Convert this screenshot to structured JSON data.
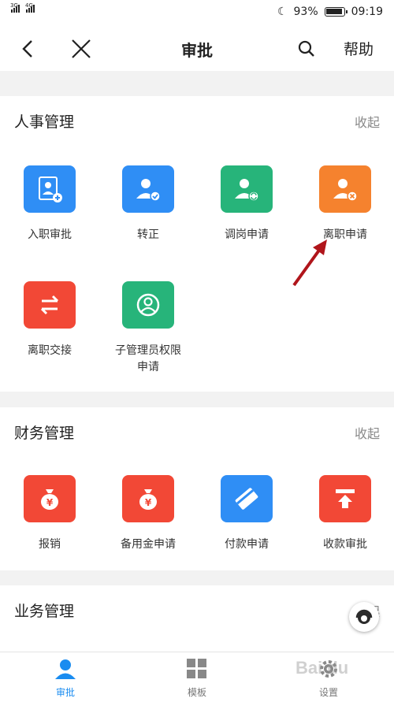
{
  "status_bar": {
    "sim1_label": "3G",
    "sim2_label": "4G",
    "battery": "93%",
    "time": "09:19"
  },
  "title_bar": {
    "title": "审批",
    "help_label": "帮助"
  },
  "sections": {
    "hr": {
      "title": "人事管理",
      "collapse": "收起",
      "items": [
        {
          "label": "入职审批",
          "color": "#2f8ef5",
          "icon": "photo-add-icon"
        },
        {
          "label": "转正",
          "color": "#2f8ef5",
          "icon": "user-check-icon"
        },
        {
          "label": "调岗申请",
          "color": "#27b47a",
          "icon": "user-transfer-icon"
        },
        {
          "label": "离职申请",
          "color": "#f5822e",
          "icon": "user-remove-icon"
        },
        {
          "label": "离职交接",
          "color": "#f24836",
          "icon": "exchange-icon"
        },
        {
          "label": "子管理员权限申请",
          "color": "#27b47a",
          "icon": "admin-user-icon"
        }
      ]
    },
    "finance": {
      "title": "财务管理",
      "collapse": "收起",
      "items": [
        {
          "label": "报销",
          "color": "#f24836",
          "icon": "money-bag-icon"
        },
        {
          "label": "备用金申请",
          "color": "#f24836",
          "icon": "money-bag-icon"
        },
        {
          "label": "付款申请",
          "color": "#2f8ef5",
          "icon": "payment-card-icon"
        },
        {
          "label": "收款审批",
          "color": "#f24836",
          "icon": "receive-money-icon"
        }
      ]
    },
    "business": {
      "title": "业务管理",
      "collapse": "收起"
    }
  },
  "bottom_nav": {
    "items": [
      {
        "label": "审批",
        "icon": "user-icon",
        "active": true
      },
      {
        "label": "模板",
        "icon": "grid-icon",
        "active": false
      },
      {
        "label": "设置",
        "icon": "gear-icon",
        "active": false
      }
    ]
  },
  "watermark": "Bai du",
  "accent_color": "#1a8cf0"
}
